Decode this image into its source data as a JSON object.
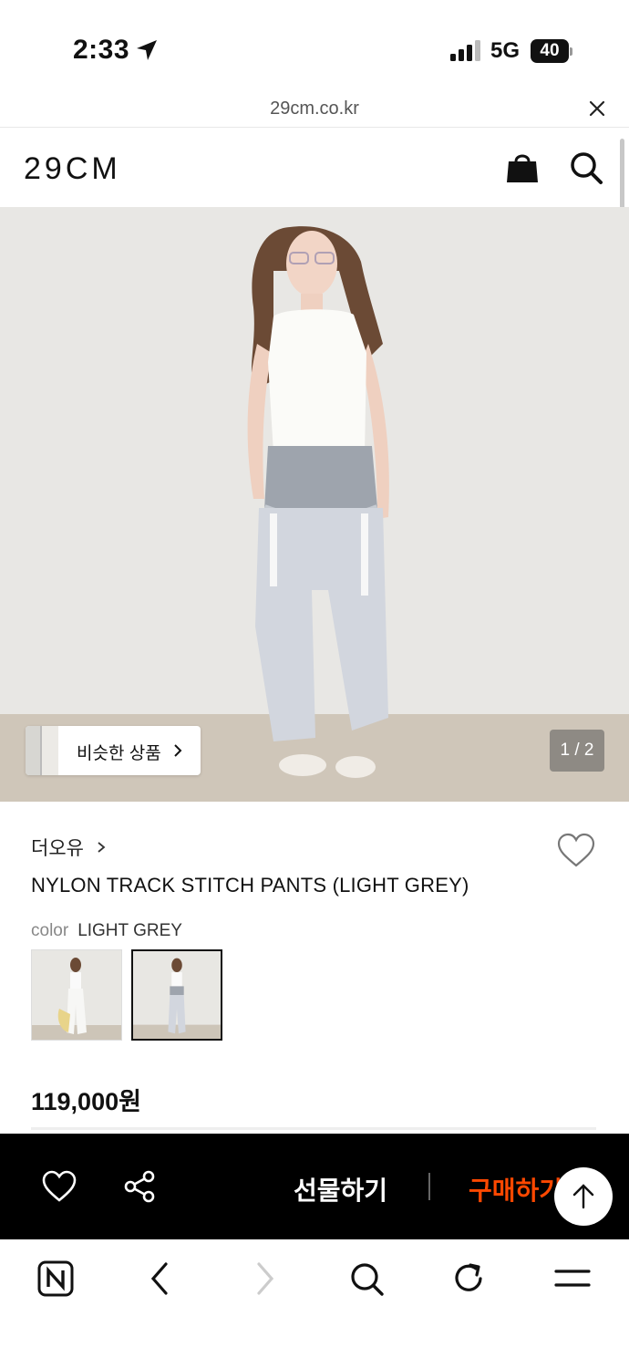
{
  "status_bar": {
    "time": "2:33",
    "network": "5G",
    "battery": "40"
  },
  "url_bar": {
    "domain": "29cm.co.kr"
  },
  "header": {
    "logo": "29CM"
  },
  "hero": {
    "similar_products_label": "비슷한 상품",
    "page_counter": "1 / 2"
  },
  "product": {
    "brand": "더오유",
    "title": "NYLON TRACK STITCH PANTS (LIGHT GREY)",
    "color_label": "color",
    "color_value": "LIGHT GREY",
    "price": "119,000원"
  },
  "action_bar": {
    "gift_label": "선물하기",
    "buy_label": "구매하기"
  },
  "colors": {
    "buy_accent": "#ff4800",
    "action_bar_bg": "#000000"
  },
  "icons": [
    "location-arrow-icon",
    "signal-icon",
    "battery-icon",
    "close-icon",
    "shopping-bag-icon",
    "search-icon",
    "chevron-right-icon",
    "heart-icon",
    "share-icon",
    "arrow-up-icon",
    "naver-n-icon",
    "back-icon",
    "forward-icon",
    "reload-icon",
    "menu-icon"
  ]
}
